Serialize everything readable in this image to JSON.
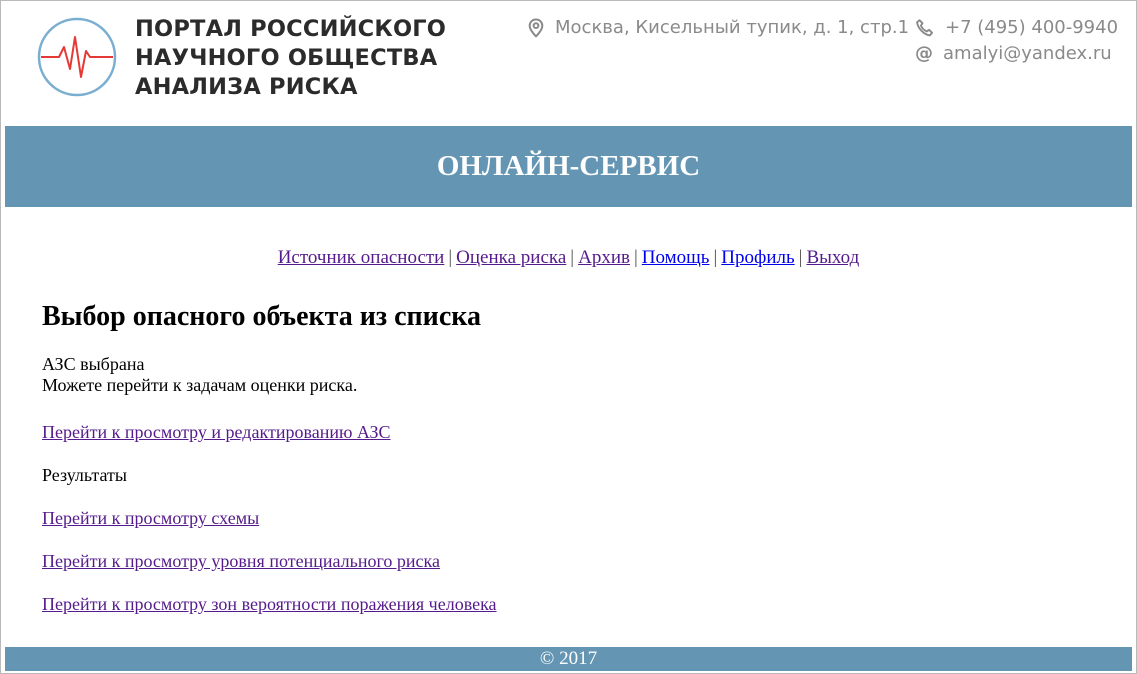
{
  "header": {
    "title_lines": [
      "ПОРТАЛ РОССИЙСКОГО",
      "НАУЧНОГО ОБЩЕСТВА",
      "АНАЛИЗА РИСКА"
    ],
    "address": "Москва, Кисельный тупик, д. 1, стр.1",
    "phone": "+7 (495) 400-9940",
    "email": "amalyi@yandex.ru"
  },
  "banner": {
    "title": "ОНЛАЙН-СЕРВИС"
  },
  "nav": {
    "items": [
      "Источник опасности",
      "Оценка риска",
      "Архив",
      "Помощь",
      "Профиль",
      "Выход"
    ],
    "separator": "|"
  },
  "main": {
    "title": "Выбор опасного объекта из списка",
    "status_line1": "АЗС выбрана",
    "status_line2": "Можете перейти к задачам оценки риска.",
    "link_edit": "Перейти к просмотру и редактированию АЗС",
    "results_label": "Результаты",
    "link_scheme": "Перейти к просмотру схемы",
    "link_risk_level": "Перейти к просмотру уровня потенциального риска",
    "link_zones": "Перейти к просмотру зон вероятности поражения человека"
  },
  "footer": {
    "copyright": "© 2017"
  },
  "colors": {
    "banner": "#6496b3",
    "visited_link": "#551a8b",
    "link": "#0000ee",
    "logo_circle": "#7aaed0",
    "logo_pulse": "#e53935"
  },
  "icons": {
    "address": "map-pin-icon",
    "phone": "phone-icon",
    "email": "at-sign-icon"
  }
}
